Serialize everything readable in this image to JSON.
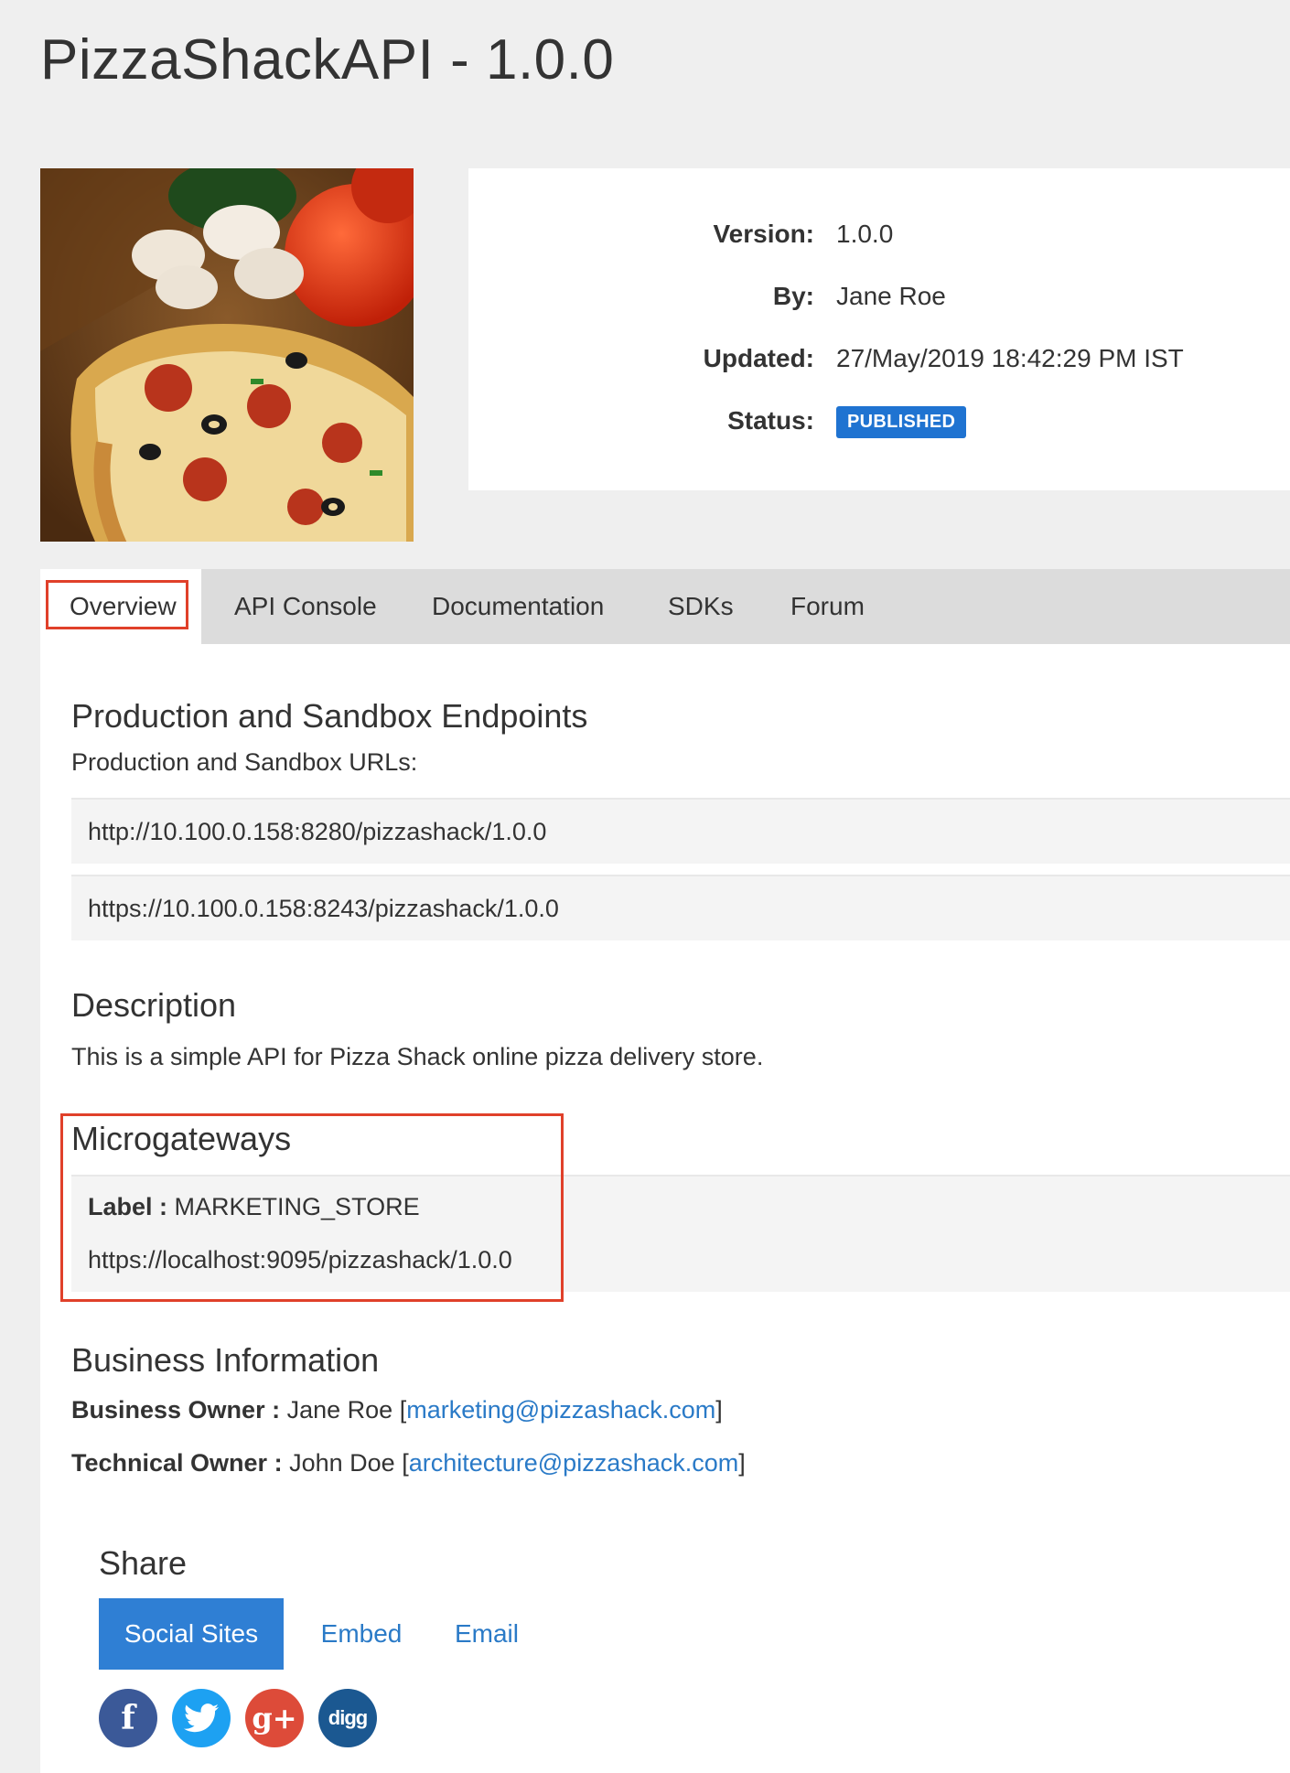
{
  "page": {
    "title": "PizzaShackAPI - 1.0.0"
  },
  "info": {
    "version_label": "Version:",
    "version": "1.0.0",
    "by_label": "By:",
    "by": "Jane Roe",
    "updated_label": "Updated:",
    "updated": "27/May/2019 18:42:29 PM IST",
    "status_label": "Status:",
    "status": "PUBLISHED"
  },
  "tabs": [
    "Overview",
    "API Console",
    "Documentation",
    "SDKs",
    "Forum"
  ],
  "endpoints": {
    "title": "Production and Sandbox Endpoints",
    "subtitle": "Production and Sandbox URLs:",
    "urls": [
      "http://10.100.0.158:8280/pizzashack/1.0.0",
      "https://10.100.0.158:8243/pizzashack/1.0.0"
    ]
  },
  "description": {
    "title": "Description",
    "text": "This is a simple API for Pizza Shack online pizza delivery store."
  },
  "microgateways": {
    "title": "Microgateways",
    "label_key": "Label :",
    "label_value": "MARKETING_STORE",
    "url": "https://localhost:9095/pizzashack/1.0.0"
  },
  "business": {
    "title": "Business Information",
    "business_owner_label": "Business Owner :",
    "business_owner_name": "Jane Roe",
    "business_owner_email": "marketing@pizzashack.com",
    "technical_owner_label": "Technical Owner :",
    "technical_owner_name": "John Doe",
    "technical_owner_email": "architecture@pizzashack.com",
    "bracket_open": "[",
    "bracket_close": "]"
  },
  "share": {
    "title": "Share",
    "tabs": [
      "Social Sites",
      "Embed",
      "Email"
    ],
    "icons": [
      {
        "name": "facebook-icon",
        "glyph": "f",
        "color": "#3b5998"
      },
      {
        "name": "twitter-icon",
        "glyph": "t",
        "color": "#1da1f2"
      },
      {
        "name": "google-plus-icon",
        "glyph": "g+",
        "color": "#dd4b39"
      },
      {
        "name": "digg-icon",
        "glyph": "digg",
        "color": "#1b5891"
      }
    ]
  },
  "colors": {
    "accent": "#1f73d1",
    "highlight": "#e0402a",
    "link": "#2a7ac7"
  }
}
